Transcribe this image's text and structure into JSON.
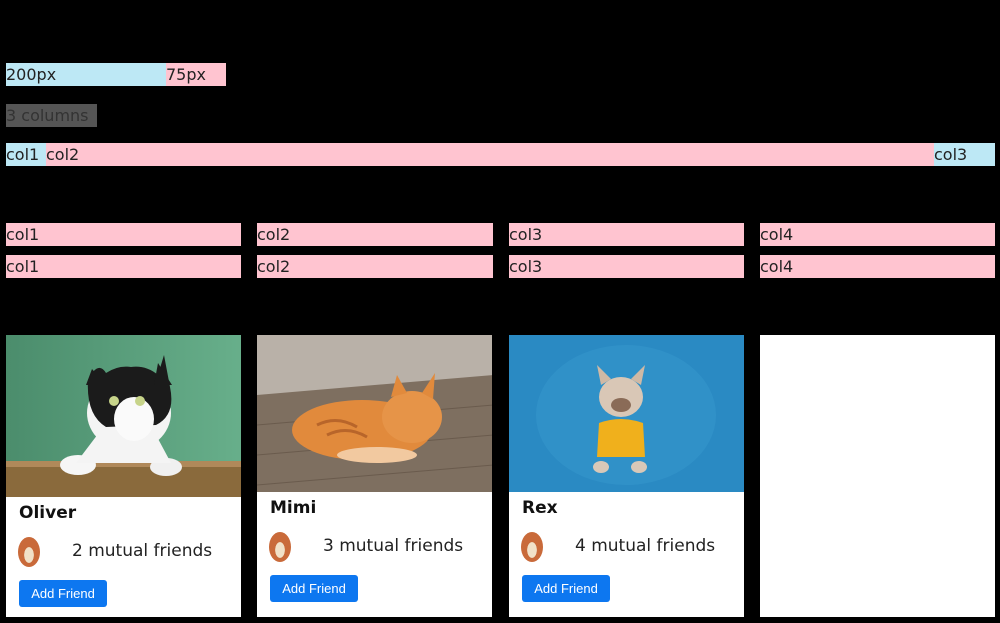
{
  "example1": {
    "col_a": "200px",
    "col_b": "75px"
  },
  "example2": {
    "label": "3 columns",
    "col1": "col1",
    "col2": "col2",
    "col3": "col3"
  },
  "grid_rows": [
    [
      "col1",
      "col2",
      "col3",
      "col4"
    ],
    [
      "col1",
      "col2",
      "col3",
      "col4"
    ]
  ],
  "cards": [
    {
      "name": "Oliver",
      "mutual": "2 mutual friends",
      "button": "Add Friend"
    },
    {
      "name": "Mimi",
      "mutual": "3 mutual friends",
      "button": "Add Friend"
    },
    {
      "name": "Rex",
      "mutual": "4 mutual friends",
      "button": "Add Friend"
    }
  ],
  "colors": {
    "blue": "#bde8f5",
    "pink": "#ffc4d0",
    "button": "#0d77f0"
  }
}
